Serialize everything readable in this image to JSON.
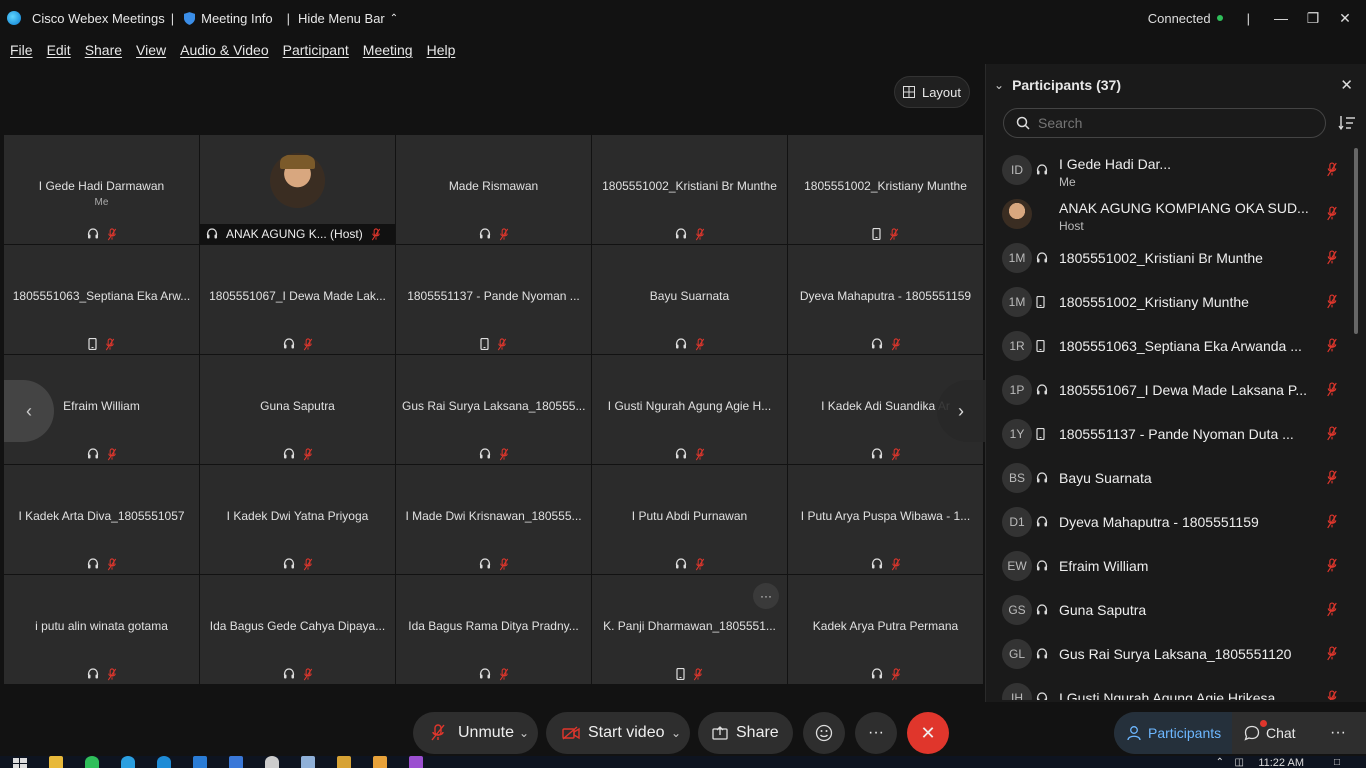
{
  "titlebar": {
    "app_title": "Cisco Webex Meetings",
    "meeting_info": "Meeting Info",
    "hide_menu": "Hide Menu Bar",
    "status": "Connected"
  },
  "menu": [
    "File",
    "Edit",
    "Share",
    "View",
    "Audio & Video",
    "Participant",
    "Meeting",
    "Help"
  ],
  "layout_button": "Layout",
  "tiles": [
    {
      "name": "I Gede Hadi Darmawan",
      "sub": "Me",
      "device": "headset"
    },
    {
      "name": "ANAK AGUNG K... (Host)",
      "sub": "",
      "device": "headset",
      "video": true
    },
    {
      "name": "Made Rismawan",
      "sub": "",
      "device": "headset"
    },
    {
      "name": "1805551002_Kristiani Br Munthe",
      "sub": "",
      "device": "headset"
    },
    {
      "name": "1805551002_Kristiany Munthe",
      "sub": "",
      "device": "phone"
    },
    {
      "name": "1805551063_Septiana Eka Arw...",
      "sub": "",
      "device": "phone"
    },
    {
      "name": "1805551067_I Dewa Made Lak...",
      "sub": "",
      "device": "headset"
    },
    {
      "name": "1805551137 - Pande Nyoman ...",
      "sub": "",
      "device": "phone"
    },
    {
      "name": "Bayu Suarnata",
      "sub": "",
      "device": "headset"
    },
    {
      "name": "Dyeva Mahaputra - 1805551159",
      "sub": "",
      "device": "headset"
    },
    {
      "name": "Efraim William",
      "sub": "",
      "device": "headset"
    },
    {
      "name": "Guna Saputra",
      "sub": "",
      "device": "headset"
    },
    {
      "name": "Gus Rai Surya Laksana_180555...",
      "sub": "",
      "device": "headset"
    },
    {
      "name": "I Gusti Ngurah Agung Agie H...",
      "sub": "",
      "device": "headset"
    },
    {
      "name": "I Kadek Adi Suandika Ar",
      "sub": "",
      "device": "headset"
    },
    {
      "name": "I Kadek Arta Diva_1805551057",
      "sub": "",
      "device": "headset"
    },
    {
      "name": "I Kadek Dwi Yatna Priyoga",
      "sub": "",
      "device": "headset"
    },
    {
      "name": "I Made Dwi Krisnawan_180555...",
      "sub": "",
      "device": "headset"
    },
    {
      "name": "I Putu Abdi Purnawan",
      "sub": "",
      "device": "headset"
    },
    {
      "name": "I Putu Arya Puspa Wibawa - 1...",
      "sub": "",
      "device": "headset"
    },
    {
      "name": "i putu alin winata gotama",
      "sub": "",
      "device": "headset"
    },
    {
      "name": "Ida Bagus Gede Cahya Dipaya...",
      "sub": "",
      "device": "headset"
    },
    {
      "name": "Ida Bagus Rama Ditya Pradny...",
      "sub": "",
      "device": "headset"
    },
    {
      "name": "K. Panji Dharmawan_1805551...",
      "sub": "",
      "device": "phone",
      "more": true
    },
    {
      "name": "Kadek Arya Putra Permana",
      "sub": "",
      "device": "headset"
    }
  ],
  "more_dots": "···",
  "panel": {
    "title": "Participants (37)",
    "search_placeholder": "Search",
    "participants": [
      {
        "initials": "ID",
        "name": "I Gede Hadi Dar...",
        "role": "Me",
        "device": "headset"
      },
      {
        "initials": "",
        "name": "ANAK AGUNG KOMPIANG OKA SUD...",
        "role": "Host",
        "device": "none",
        "photo": true
      },
      {
        "initials": "1M",
        "name": "1805551002_Kristiani Br Munthe",
        "role": "",
        "device": "headset"
      },
      {
        "initials": "1M",
        "name": "1805551002_Kristiany Munthe",
        "role": "",
        "device": "phone"
      },
      {
        "initials": "1R",
        "name": "1805551063_Septiana Eka Arwanda ...",
        "role": "",
        "device": "phone"
      },
      {
        "initials": "1P",
        "name": "1805551067_I Dewa Made Laksana P...",
        "role": "",
        "device": "headset"
      },
      {
        "initials": "1Y",
        "name": "1805551137 - Pande Nyoman Duta ...",
        "role": "",
        "device": "phone"
      },
      {
        "initials": "BS",
        "name": "Bayu Suarnata",
        "role": "",
        "device": "headset"
      },
      {
        "initials": "D1",
        "name": "Dyeva Mahaputra - 1805551159",
        "role": "",
        "device": "headset"
      },
      {
        "initials": "EW",
        "name": "Efraim William",
        "role": "",
        "device": "headset"
      },
      {
        "initials": "GS",
        "name": "Guna Saputra",
        "role": "",
        "device": "headset"
      },
      {
        "initials": "GL",
        "name": "Gus Rai Surya Laksana_1805551120",
        "role": "",
        "device": "headset"
      },
      {
        "initials": "IH",
        "name": "I Gusti Ngurah Agung Agie Hrikesa",
        "role": "",
        "device": "headset"
      }
    ]
  },
  "controls": {
    "unmute": "Unmute",
    "start_video": "Start video",
    "share": "Share",
    "more": "···"
  },
  "tabs": {
    "participants": "Participants",
    "chat": "Chat",
    "more": "···"
  },
  "taskbar": {
    "clock": "11:22 AM"
  },
  "colors": {
    "mute_red": "#e0362c",
    "accent_blue": "#6db7ff",
    "connected_green": "#2fbf5a"
  }
}
